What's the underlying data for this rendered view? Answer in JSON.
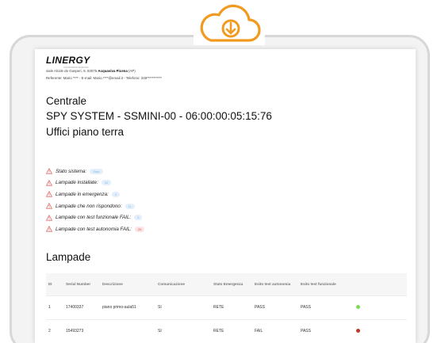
{
  "colors": {
    "accent_orange": "#f29a1f",
    "frame": "#d7d7d7",
    "dot_green": "#7ed957",
    "dot_red": "#c0392b"
  },
  "icons": {
    "cloud": "cloud-download-icon",
    "warning": "warning-icon"
  },
  "report": {
    "logo": "LINERGY",
    "logo_sub": "CONSORZIO EUROPA",
    "address_line1_prefix": "viale Alcide de Gasperi, 9, 63075 ",
    "address_line1_city": "Acquaviva Picena",
    "address_line1_suffix": " (AP)",
    "address_line2": "Referente: Mario **** - E-mail: Mario.****@email.it - Telefono: 349***********",
    "title1": "Centrale",
    "title2": "SPY SYSTEM - SSMINI-00 - 06:00:00:05:15:76",
    "title3": "Uffici piano terra",
    "status": [
      {
        "label": "Stato sistema:",
        "value": "Start",
        "tone": "blue"
      },
      {
        "label": "Lampade installate:",
        "value": "33",
        "tone": "blue"
      },
      {
        "label": "Lampade in emergenza:",
        "value": "0",
        "tone": "blue"
      },
      {
        "label": "Lampade che non rispondono:",
        "value": "11",
        "tone": "blue"
      },
      {
        "label": "Lampade con test funzionale FAIL:",
        "value": "3",
        "tone": "blue"
      },
      {
        "label": "Lampade con test autonomia FAIL:",
        "value": "20",
        "tone": "red"
      }
    ],
    "lampade_title": "Lampade",
    "table": {
      "headers": [
        "ID",
        "Serial Number",
        "Descrizione",
        "Comunicazione",
        "Stato Emergenza",
        "Esito test autonomia",
        "Esito test funzionale",
        ""
      ],
      "rows": [
        {
          "id": "1",
          "serial": "17400337",
          "descr": "piano primo-aula51",
          "com": "SI",
          "stato": "RETE",
          "autonomia": "PASS",
          "funzionale": "PASS",
          "dot": "green"
        },
        {
          "id": "2",
          "serial": "15493273",
          "descr": "",
          "com": "SI",
          "stato": "RETE",
          "autonomia": "FAIL",
          "funzionale": "PASS",
          "dot": "red"
        }
      ]
    }
  }
}
